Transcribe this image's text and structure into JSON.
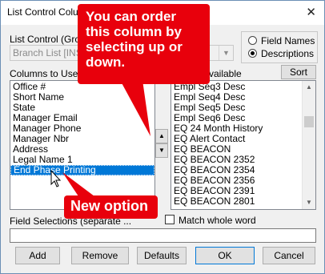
{
  "window": {
    "title": "List Control Colu"
  },
  "list_control": {
    "label": "List Control (Grou",
    "value": "Branch List [INST"
  },
  "radio_group": {
    "options": [
      {
        "label": "Field Names",
        "selected": false
      },
      {
        "label": "Descriptions",
        "selected": true
      }
    ]
  },
  "columns_to_use": {
    "label": "Columns to Use",
    "items": [
      "Office #",
      "Short Name",
      "State",
      "Manager Email",
      "Manager Phone",
      "Manager Nbr",
      "Address",
      "Legal Name 1",
      "End Phase Printing"
    ],
    "selected": "End Phase Printing"
  },
  "available": {
    "label": "vailable",
    "items": [
      "Empl Seq3 Desc",
      "Empl Seq4 Desc",
      "Empl Seq5 Desc",
      "Empl Seq6 Desc",
      "EQ 24 Month History",
      "EQ Alert Contact",
      "EQ BEACON",
      "EQ BEACON 2352",
      "EQ BEACON 2354",
      "EQ BEACON 2356",
      "EQ BEACON 2391",
      "EQ BEACON 2801"
    ]
  },
  "sort_button": "Sort",
  "field_selections": {
    "label": "Field Selections (separate ...",
    "value": ""
  },
  "match_whole_word": {
    "label": "Match whole word",
    "checked": false
  },
  "buttons": {
    "add": "Add",
    "remove": "Remove",
    "defaults": "Defaults",
    "ok": "OK",
    "cancel": "Cancel"
  },
  "callouts": {
    "order": "You can order\nthis column by\nselecting up or\ndown.",
    "new_option": "New option"
  },
  "colors": {
    "callout": "#e8000c",
    "selection": "#0078d7"
  },
  "icons": {
    "close": "close-icon",
    "up": "arrow-up-icon",
    "down": "arrow-down-icon",
    "cursor": "mouse-pointer-icon"
  }
}
